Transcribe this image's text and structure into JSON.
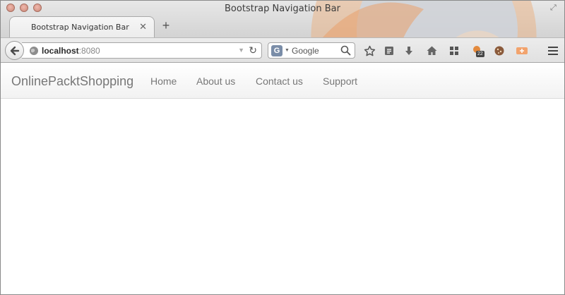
{
  "browser": {
    "window_title": "Bootstrap Navigation Bar",
    "tab": {
      "label": "Bootstrap Navigation Bar",
      "close_glyph": "✕"
    },
    "new_tab_glyph": "+",
    "urlbar": {
      "host": "localhost",
      "port": ":8080"
    },
    "search": {
      "placeholder": "Google",
      "engine_icon": "G"
    },
    "toolbar_icons": [
      "back-icon",
      "bookmark-star-icon",
      "reading-list-icon",
      "download-icon",
      "home-icon",
      "grid-icon",
      "calendar-icon",
      "cookie-icon",
      "extension-icon",
      "menu-icon"
    ],
    "calendar_badge": "22"
  },
  "navbar": {
    "brand": "OnlinePacktShopping",
    "links": [
      "Home",
      "About us",
      "Contact us",
      "Support"
    ]
  }
}
